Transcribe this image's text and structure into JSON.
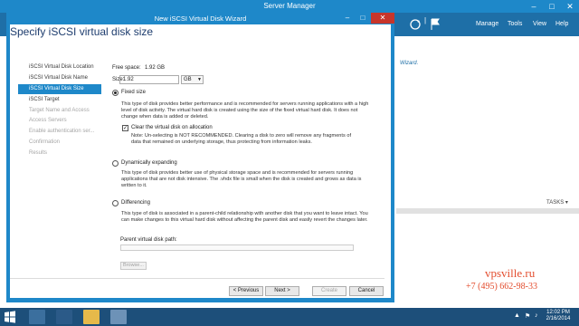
{
  "server_manager": {
    "title": "Server Manager",
    "menu": [
      "Manage",
      "Tools",
      "View",
      "Help"
    ],
    "wizard_link_fragment": "Wizard.",
    "tasks_label": "TASKS ▾"
  },
  "wizard": {
    "window_title": "New iSCSI Virtual Disk Wizard",
    "page_title": "Specify iSCSI virtual disk size",
    "nav": [
      {
        "label": "iSCSI Virtual Disk Location",
        "state": "normal"
      },
      {
        "label": "iSCSI Virtual Disk Name",
        "state": "normal"
      },
      {
        "label": "iSCSI Virtual Disk Size",
        "state": "active"
      },
      {
        "label": "iSCSI Target",
        "state": "normal"
      },
      {
        "label": "Target Name and Access",
        "state": "disabled"
      },
      {
        "label": "Access Servers",
        "state": "disabled"
      },
      {
        "label": "Enable authentication ser...",
        "state": "disabled"
      },
      {
        "label": "Confirmation",
        "state": "disabled"
      },
      {
        "label": "Results",
        "state": "disabled"
      }
    ],
    "free_space_label": "Free space:",
    "free_space_value": "1.92 GB",
    "size_label": "Size:",
    "size_value": "1.92",
    "size_unit": "GB",
    "fixed": {
      "label": "Fixed size",
      "selected": true,
      "description": "This type of disk provides better performance and is recommended for servers running applications with a high level of disk activity. The virtual hard disk is created using the size of the fixed virtual hard disk. It does not change when data is added or deleted.",
      "clear_label": "Clear the virtual disk on allocation",
      "clear_checked": true,
      "note": "Note: Un-selecting is NOT RECOMMENDED. Clearing a disk to zero will remove any fragments of data that remained on underlying storage, thus protecting from information leaks."
    },
    "dynamic": {
      "label": "Dynamically expanding",
      "selected": false,
      "description": "This type of disk provides better use of physical storage space and is recommended for servers running applications that are not disk intensive. The .vhdx file is small when the disk is created and grows as data is written to it."
    },
    "differencing": {
      "label": "Differencing",
      "selected": false,
      "description": "This type of disk is associated in a parent-child relationship with another disk that you want to leave intact. You can make changes to this virtual hard disk without affecting the parent disk and easily revert the changes later.",
      "parent_path_label": "Parent virtual disk path:",
      "parent_path_value": "",
      "browse_label": "Browse..."
    },
    "buttons": {
      "previous": "< Previous",
      "next": "Next >",
      "create": "Create",
      "cancel": "Cancel"
    }
  },
  "watermark": {
    "site": "vpsville.ru",
    "phone": "+7 (495) 662-98-33"
  },
  "taskbar": {
    "time": "12:02 PM",
    "date": "2/16/2014"
  },
  "colors": {
    "accent": "#1e88c9",
    "dialog_title_bar": "#1e88c9",
    "taskbar": "#1d4f7a",
    "watermark": "#e34d2e"
  }
}
